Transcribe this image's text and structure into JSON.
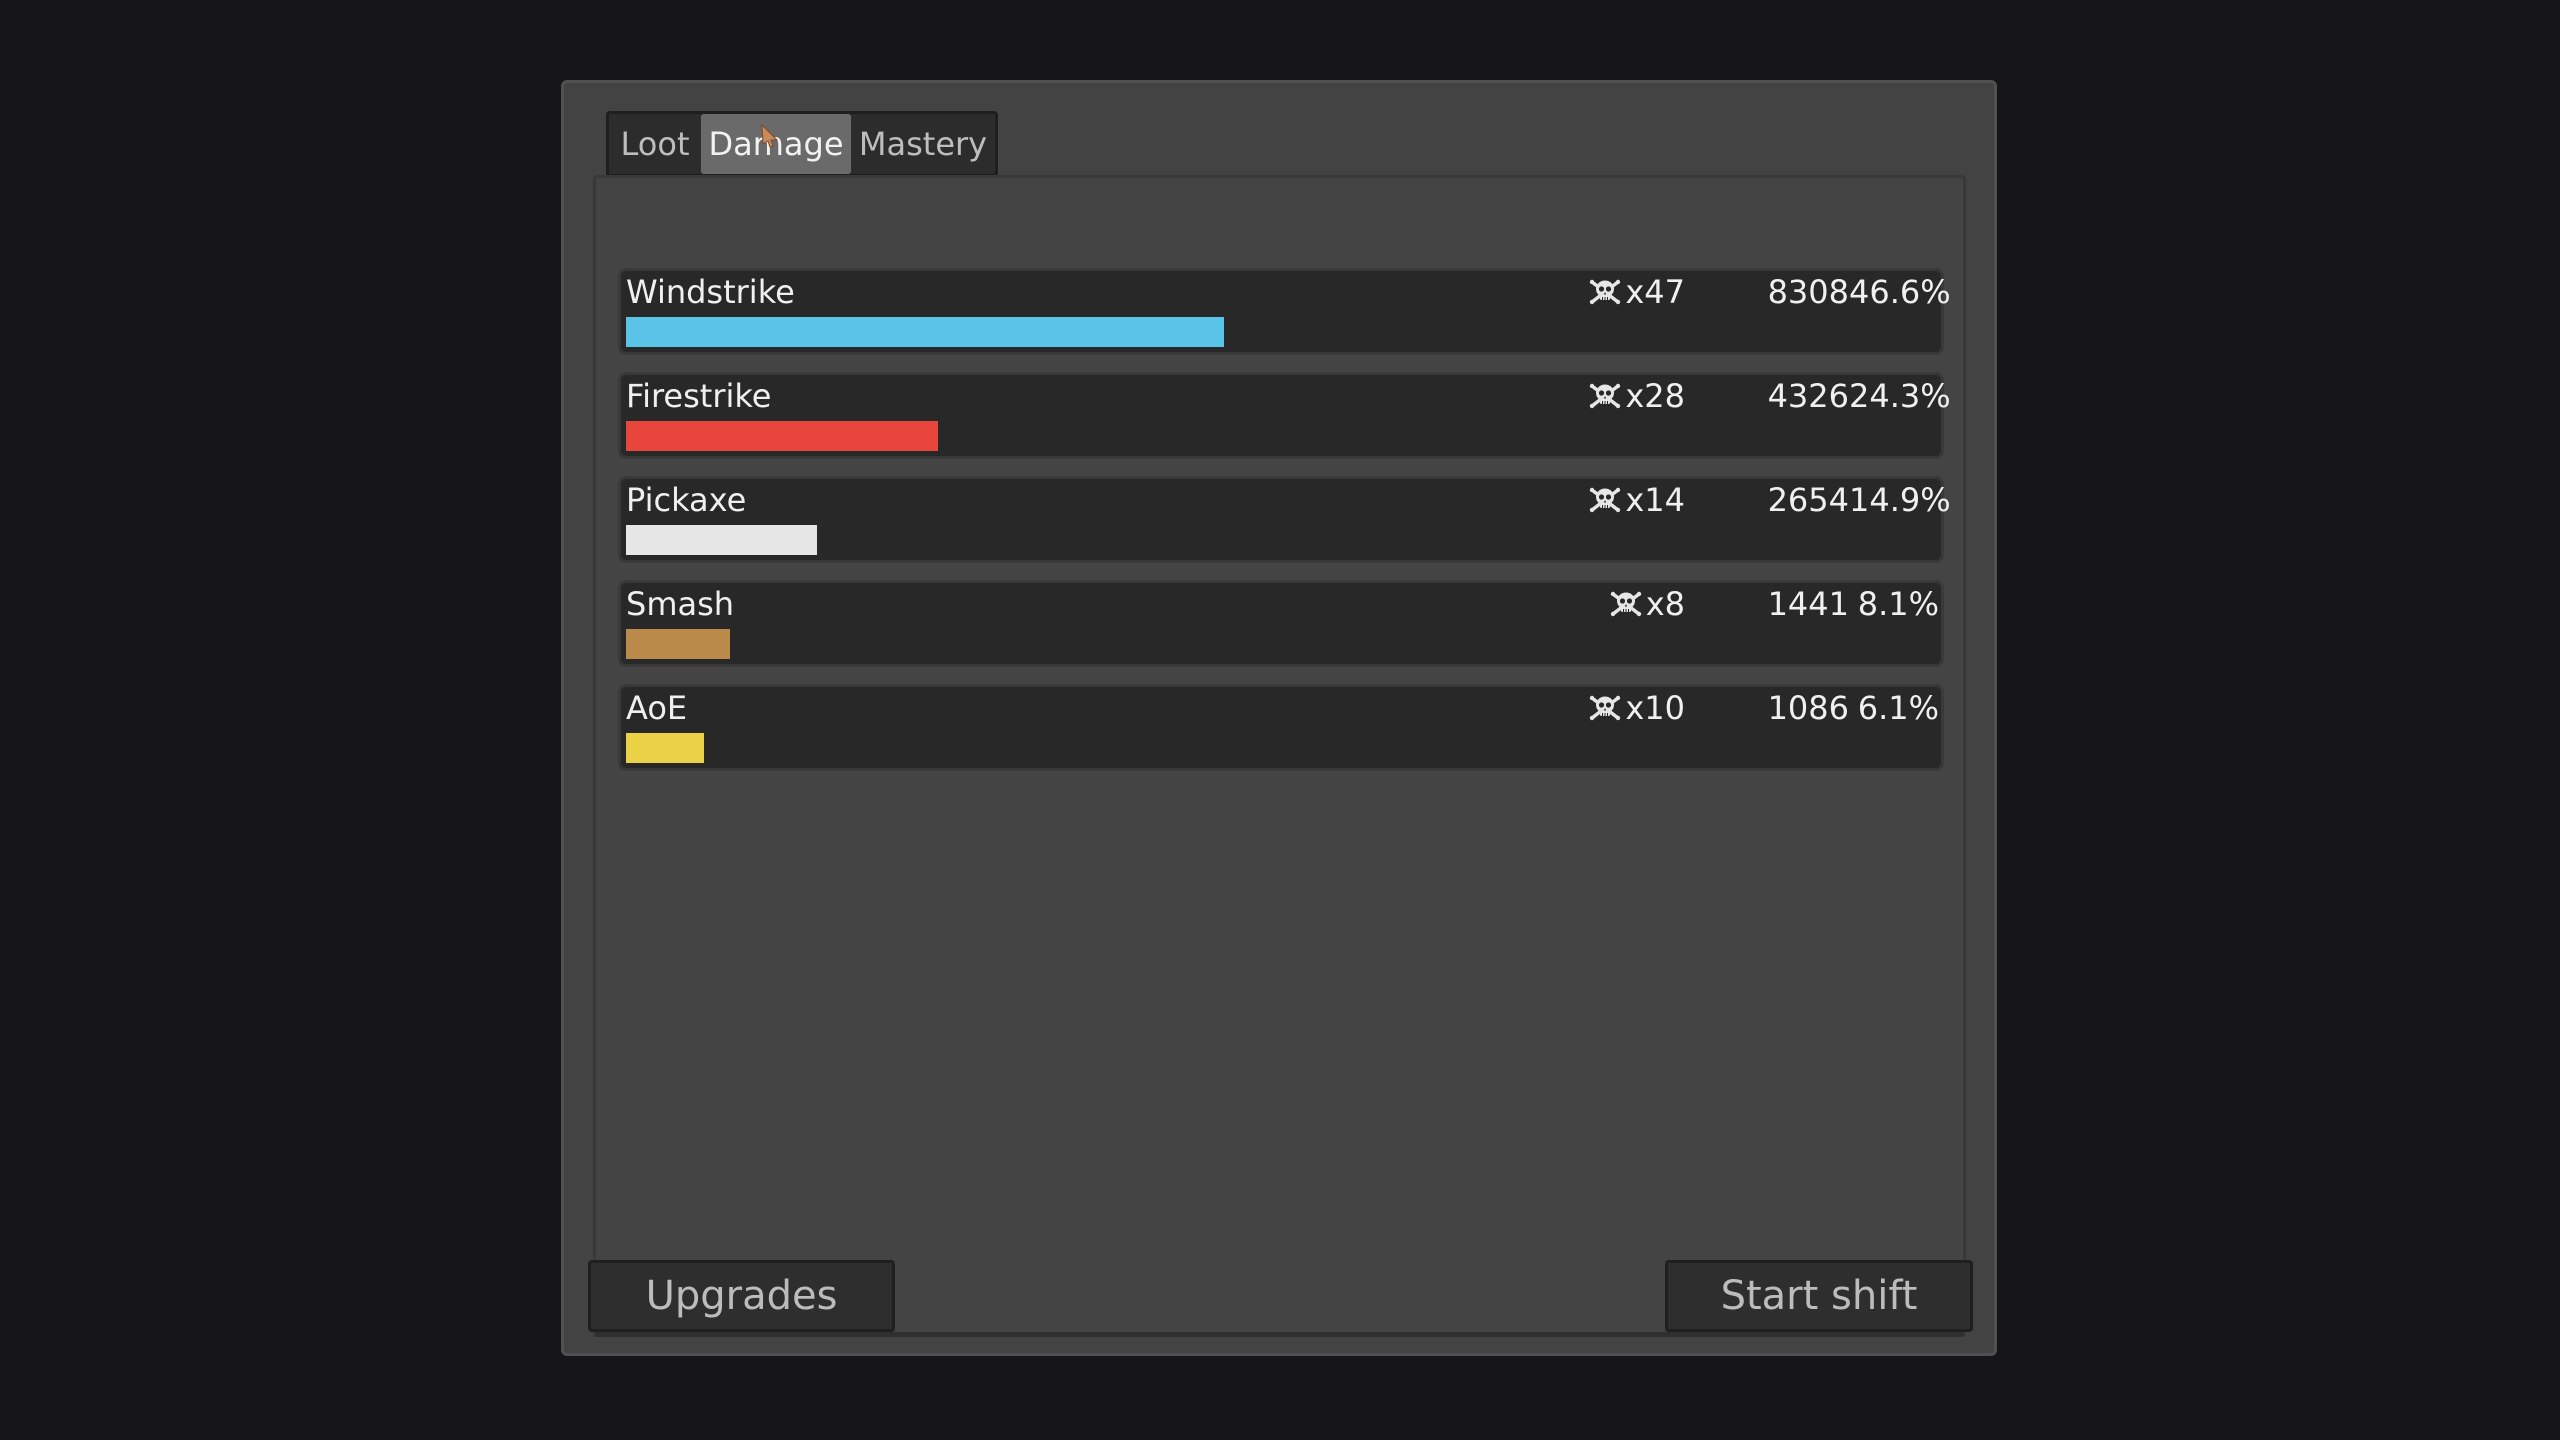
{
  "tabs": [
    {
      "label": "Loot",
      "active": false
    },
    {
      "label": "Damage",
      "active": true
    },
    {
      "label": "Mastery",
      "active": false
    }
  ],
  "skills": [
    {
      "name": "Windstrike",
      "kills": "x47",
      "damage": "8308",
      "percent": "46.6%",
      "share": 0.466,
      "color": "#59c3e8"
    },
    {
      "name": "Firestrike",
      "kills": "x28",
      "damage": "4326",
      "percent": "24.3%",
      "share": 0.243,
      "color": "#e8453d"
    },
    {
      "name": "Pickaxe",
      "kills": "x14",
      "damage": "2654",
      "percent": "14.9%",
      "share": 0.149,
      "color": "#e6e6e6"
    },
    {
      "name": "Smash",
      "kills": "x8",
      "damage": "1441",
      "percent": "8.1%",
      "share": 0.081,
      "color": "#b98a49"
    },
    {
      "name": "AoE",
      "kills": "x10",
      "damage": "1086",
      "percent": "6.1%",
      "share": 0.061,
      "color": "#ebd145"
    }
  ],
  "buttons": {
    "upgrades": "Upgrades",
    "start_shift": "Start shift"
  },
  "icons": {
    "kills": "skull-crossbones-icon"
  }
}
